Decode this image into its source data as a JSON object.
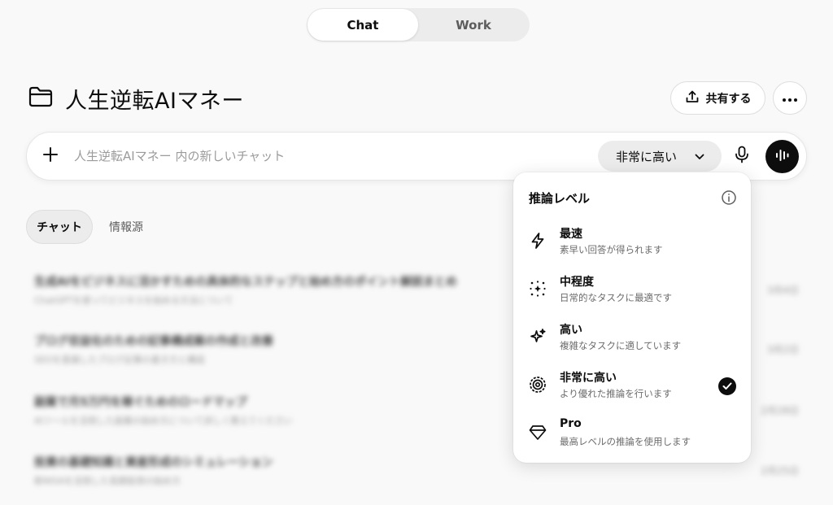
{
  "mode_switch": {
    "chat_label": "Chat",
    "work_label": "Work",
    "active": "chat"
  },
  "project": {
    "title": "人生逆転AIマネー"
  },
  "header": {
    "share_label": "共有する"
  },
  "composer": {
    "placeholder": "人生逆転AIマネー 内の新しいチャット",
    "reasoning_selected": "非常に高い"
  },
  "tabs": {
    "chat_label": "チャット",
    "sources_label": "情報源"
  },
  "chat_list": [
    {
      "title": "生成AIをビジネスに活かすための具体的なステップと始め方のポイント解説まとめ",
      "preview": "ChatGPTを使ってビジネスを始める方法について",
      "date": "3月4日"
    },
    {
      "title": "ブログ収益化のための記事構成案の作成と改善",
      "preview": "SEOを意識したブログ記事の書き方と構成",
      "date": "3月2日"
    },
    {
      "title": "副業で月5万円を稼ぐためのロードマップ",
      "preview": "AIツールを活用した副業の始め方について詳しく教えてください",
      "date": "2月28日"
    },
    {
      "title": "投資の基礎知識と資産形成のシミュレーション",
      "preview": "新NISAを活用した長期投資の始め方",
      "date": "2月25日"
    }
  ],
  "dropdown": {
    "title": "推論レベル",
    "selected_index": 3,
    "options": [
      {
        "label": "最速",
        "desc": "素早い回答が得られます",
        "icon": "lightning-icon"
      },
      {
        "label": "中程度",
        "desc": "日常的なタスクに最適です",
        "icon": "sparkle-dots-icon"
      },
      {
        "label": "高い",
        "desc": "複雑なタスクに適しています",
        "icon": "sparkle-icon"
      },
      {
        "label": "非常に高い",
        "desc": "より優れた推論を行います",
        "icon": "concentric-circles-icon"
      },
      {
        "label": "Pro",
        "desc": "最高レベルの推論を使用します",
        "icon": "diamond-icon"
      }
    ]
  }
}
